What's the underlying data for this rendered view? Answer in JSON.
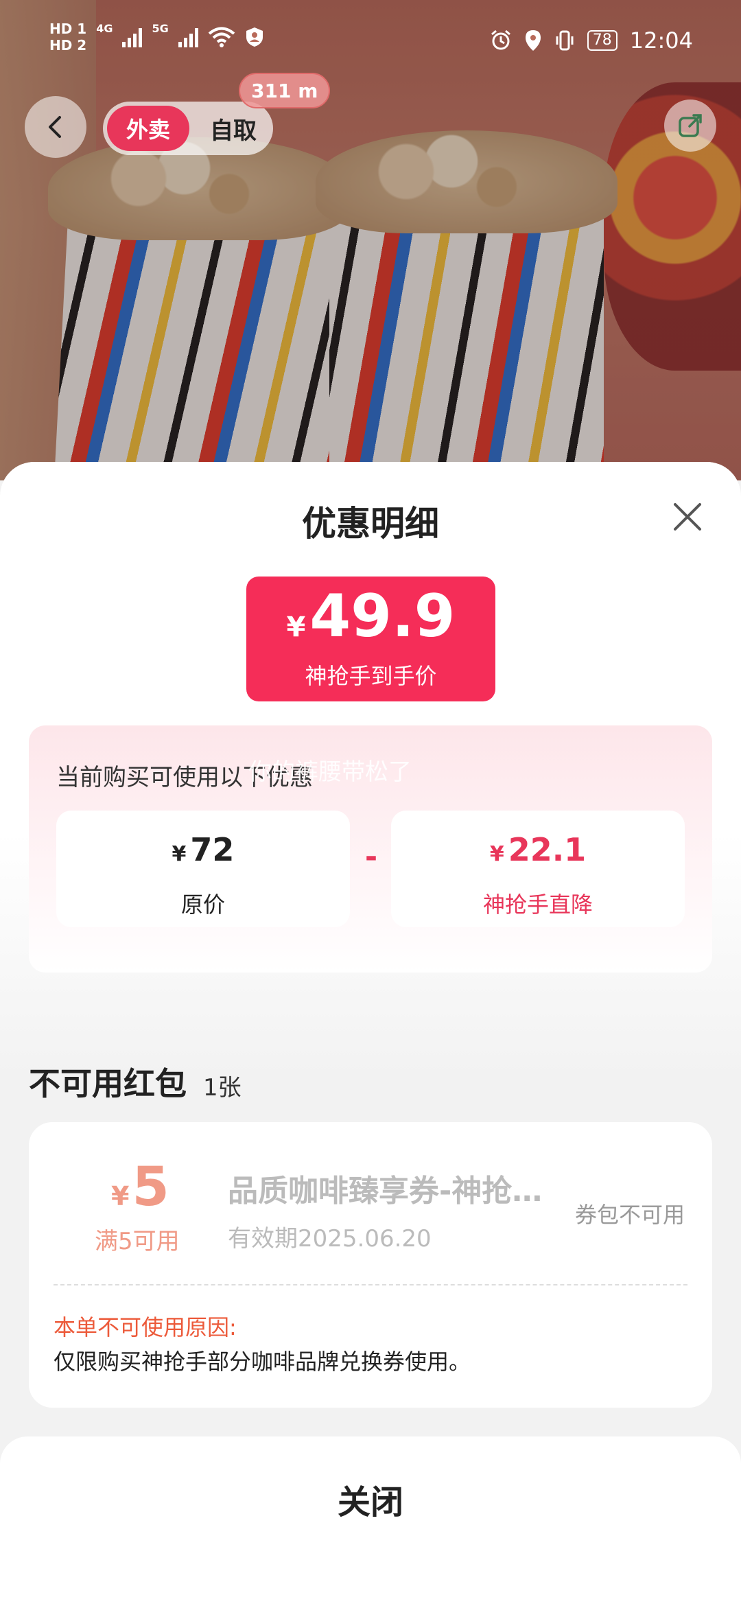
{
  "status_bar": {
    "time": "12:04",
    "battery": "78",
    "network_left": [
      "4G",
      "5G"
    ],
    "hd_labels": [
      "HD 1",
      "HD 2"
    ],
    "icons": [
      "signal-icon",
      "wifi-icon",
      "user-shield-icon",
      "alarm-icon",
      "location-icon",
      "vibrate-icon",
      "battery-icon"
    ]
  },
  "top_nav": {
    "delivery_label": "外卖",
    "pickup_label": "自取",
    "distance": "311 m",
    "back_icon": "chevron-left-icon",
    "share_icon": "share-icon"
  },
  "sheet": {
    "title": "优惠明细",
    "close_icon": "close-icon",
    "price": {
      "currency": "¥",
      "amount": "49.9",
      "label": "神抢手到手价"
    },
    "promo": {
      "label": "当前购买可使用以下优惠",
      "watermark": "你的裤腰带松了",
      "original": {
        "currency": "¥",
        "amount": "72",
        "label": "原价"
      },
      "operator": "-",
      "discount": {
        "currency": "¥",
        "amount": "22.1",
        "label": "神抢手直降"
      }
    },
    "unavailable": {
      "title": "不可用红包",
      "count": "1张",
      "coupon": {
        "currency": "¥",
        "amount": "5",
        "min_spend": "满5可用",
        "name": "品质咖啡臻享券-神抢手专享",
        "validity": "有效期2025.06.20",
        "status": "券包不可用",
        "reason_title": "本单不可使用原因:",
        "reason": "仅限购买神抢手部分咖啡品牌兑换券使用。"
      }
    },
    "close_button": "关闭"
  },
  "colors": {
    "accent": "#f52d58",
    "discount_text": "#e8365a",
    "coupon_disabled": "#f09a86",
    "reason_title": "#ec5a3a"
  }
}
